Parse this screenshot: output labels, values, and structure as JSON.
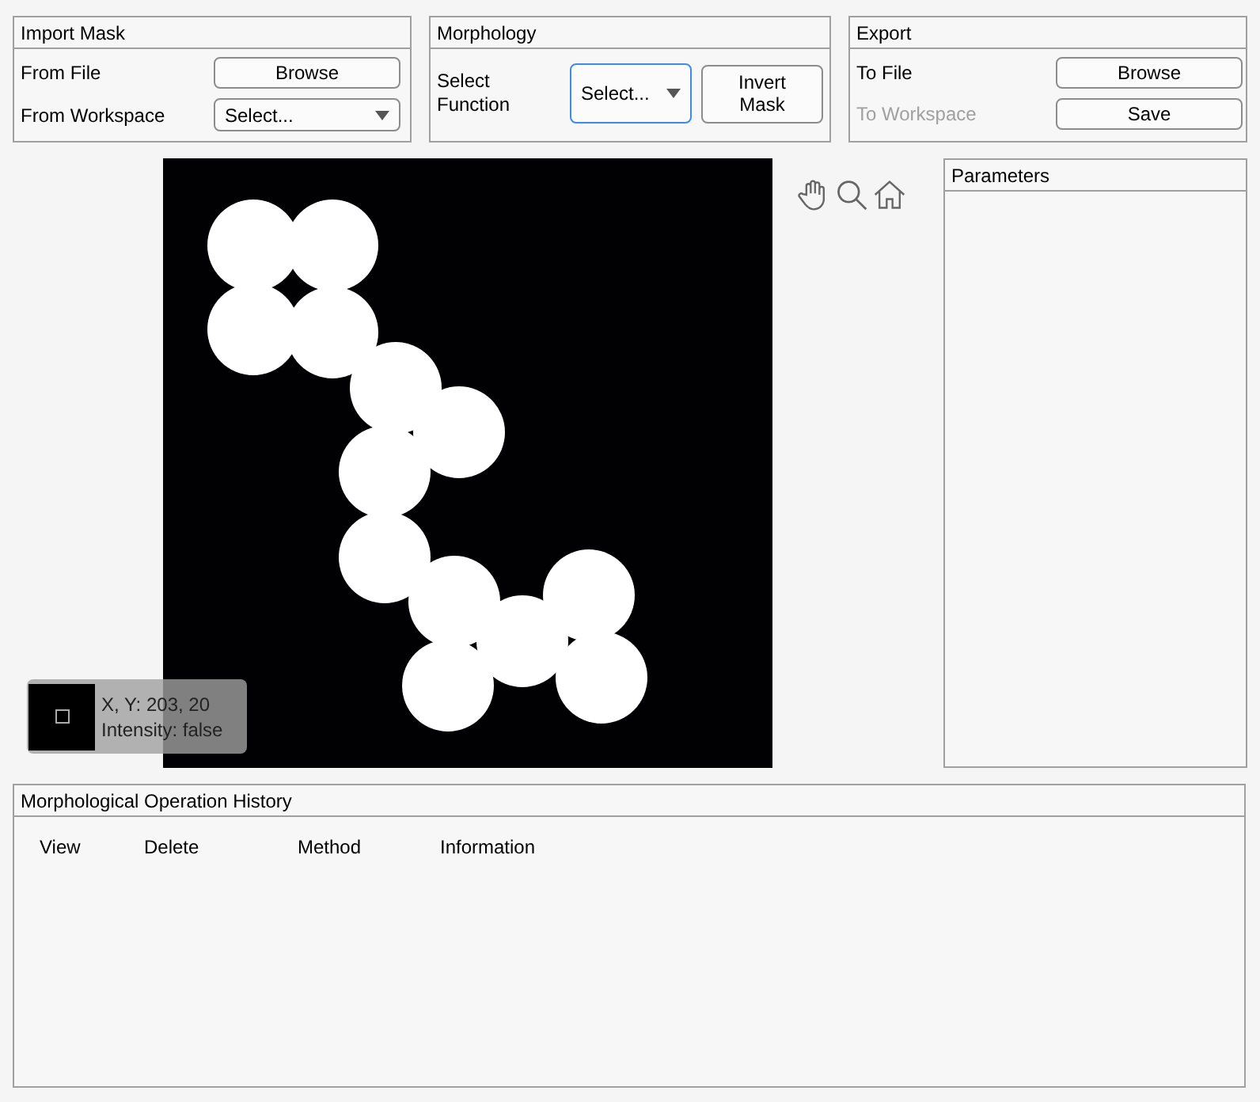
{
  "import_mask": {
    "title": "Import Mask",
    "from_file_label": "From File",
    "browse_button": "Browse",
    "from_workspace_label": "From Workspace",
    "workspace_dropdown": "Select..."
  },
  "morphology": {
    "title": "Morphology",
    "select_function_label": "Select Function",
    "function_dropdown": "Select...",
    "invert_button": "Invert Mask"
  },
  "export": {
    "title": "Export",
    "to_file_label": "To File",
    "browse_button": "Browse",
    "to_workspace_label": "To Workspace",
    "to_workspace_disabled": true,
    "save_button": "Save"
  },
  "pixel_info": {
    "coords": "X, Y: 203, 20",
    "intensity": "Intensity: false"
  },
  "parameters": {
    "title": "Parameters"
  },
  "history": {
    "title": "Morphological Operation History",
    "columns": [
      "View",
      "Delete",
      "Method",
      "Information"
    ]
  }
}
